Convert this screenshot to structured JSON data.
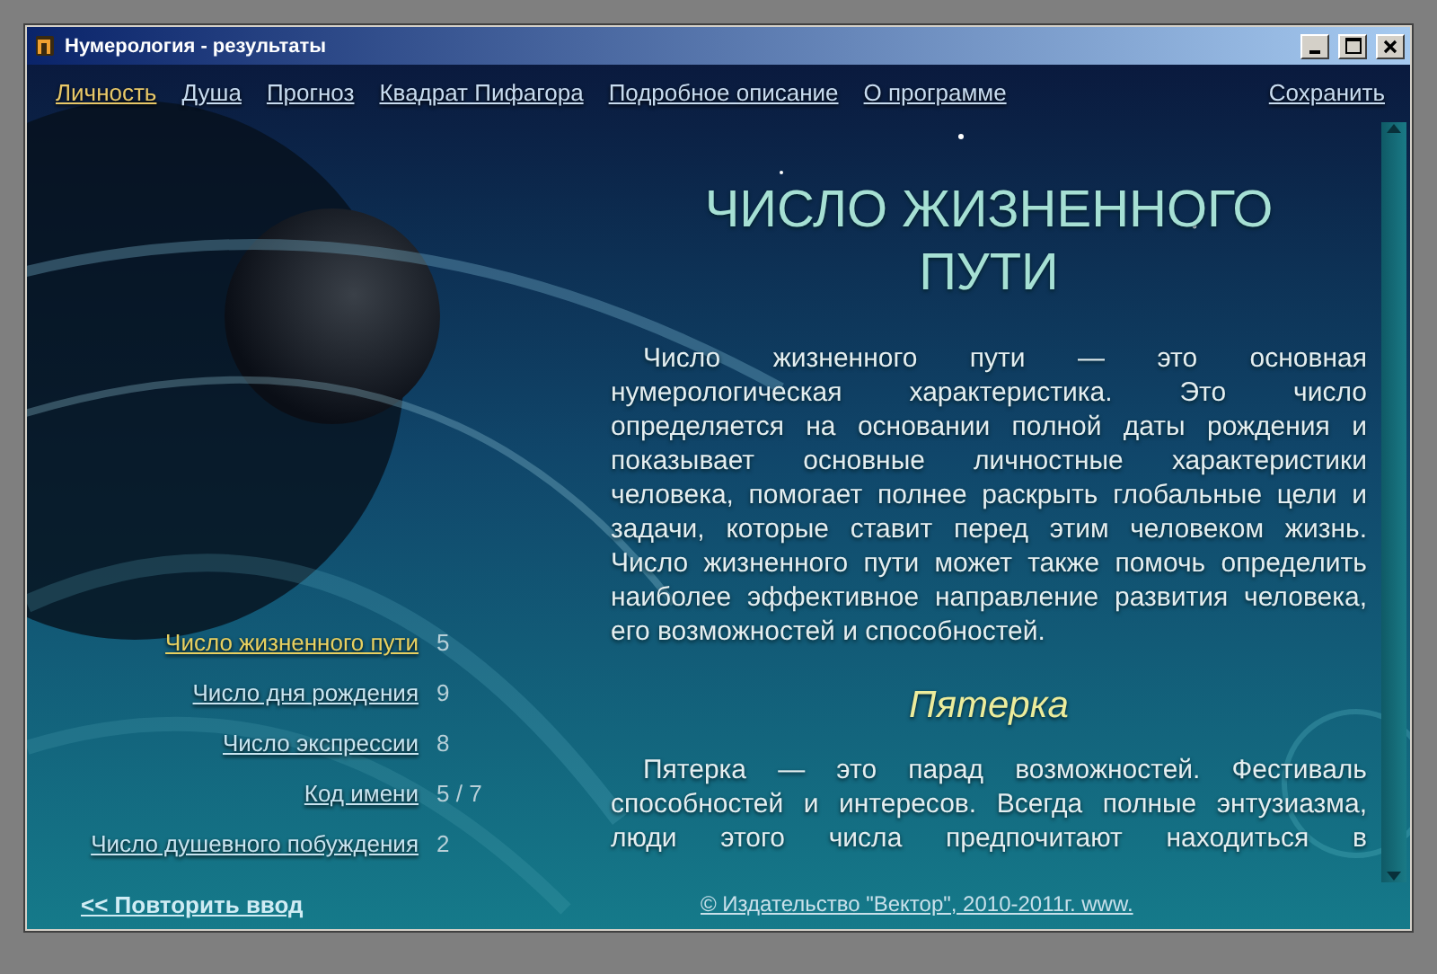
{
  "window": {
    "title": "Нумерология - результаты"
  },
  "nav": {
    "items": [
      {
        "label": "Личность",
        "selected": true
      },
      {
        "label": "Душа",
        "selected": false
      },
      {
        "label": "Прогноз",
        "selected": false
      },
      {
        "label": "Квадрат Пифагора",
        "selected": false
      },
      {
        "label": "Подробное описание",
        "selected": false
      },
      {
        "label": "О программе",
        "selected": false
      }
    ],
    "save": "Сохранить"
  },
  "numbers": [
    {
      "label": "Число жизненного пути",
      "value": "5",
      "selected": true
    },
    {
      "label": "Число дня рождения",
      "value": "9",
      "selected": false
    },
    {
      "label": "Число экспрессии",
      "value": "8",
      "selected": false
    },
    {
      "label": "Код имени",
      "value": "5 / 7",
      "selected": false
    },
    {
      "label": "Число душевного побуждения",
      "value": "2",
      "selected": false
    }
  ],
  "article": {
    "title": "ЧИСЛО ЖИЗНЕННОГО ПУТИ",
    "paragraph": "Число жизненного пути — это основная нумерологическая характеристика. Это число определяется на основании полной даты рождения и показывает основные личностные характеристики человека, помогает полнее раскрыть глобальные цели и задачи, которые ставит перед этим человеком жизнь. Число жизненного пути может также помочь определить наиболее эффективное направление развития человека, его возможностей и способностей.",
    "subtitle": "Пятерка",
    "paragraph_2": "Пятерка — это парад возможностей. Фестиваль способностей и интересов. Всегда полные энтузиазма, люди этого числа предпочитают находиться в"
  },
  "footer": {
    "back": "<< Повторить ввод",
    "copyright": "© Издательство \"Вектор\", 2010-2011г. www."
  }
}
